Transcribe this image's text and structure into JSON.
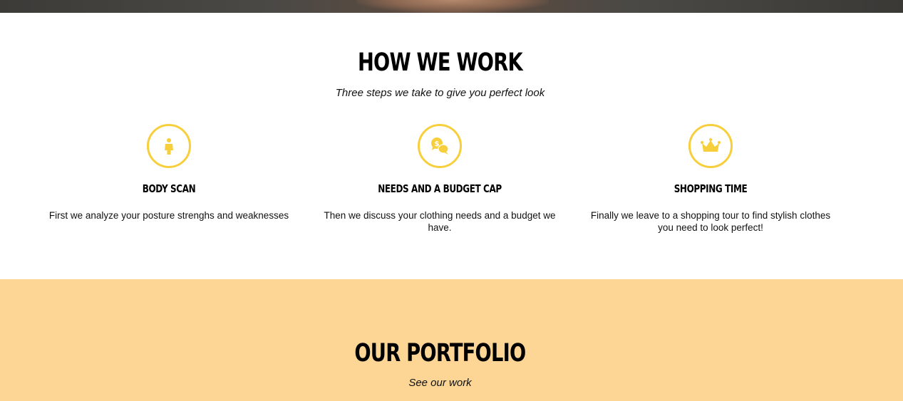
{
  "how_we_work": {
    "title": "How We Work",
    "subtitle": "Three steps we take to give you perfect look",
    "steps": [
      {
        "icon": "person-icon",
        "name": "Body Scan",
        "description": "First we analyze your posture strenghs and weaknesses"
      },
      {
        "icon": "money-chat-icon",
        "name": "Needs and a budget cap",
        "description": "Then we discuss your clothing needs and a budget we have."
      },
      {
        "icon": "crown-icon",
        "name": "Shopping time",
        "description": "Finally we leave to a shopping tour to find stylish clothes you need to look perfect!"
      }
    ]
  },
  "portfolio": {
    "title": "Our Portfolio",
    "subtitle": "See our work"
  },
  "colors": {
    "accent": "#f7cf3c",
    "portfolio_background": "#fdd595"
  }
}
